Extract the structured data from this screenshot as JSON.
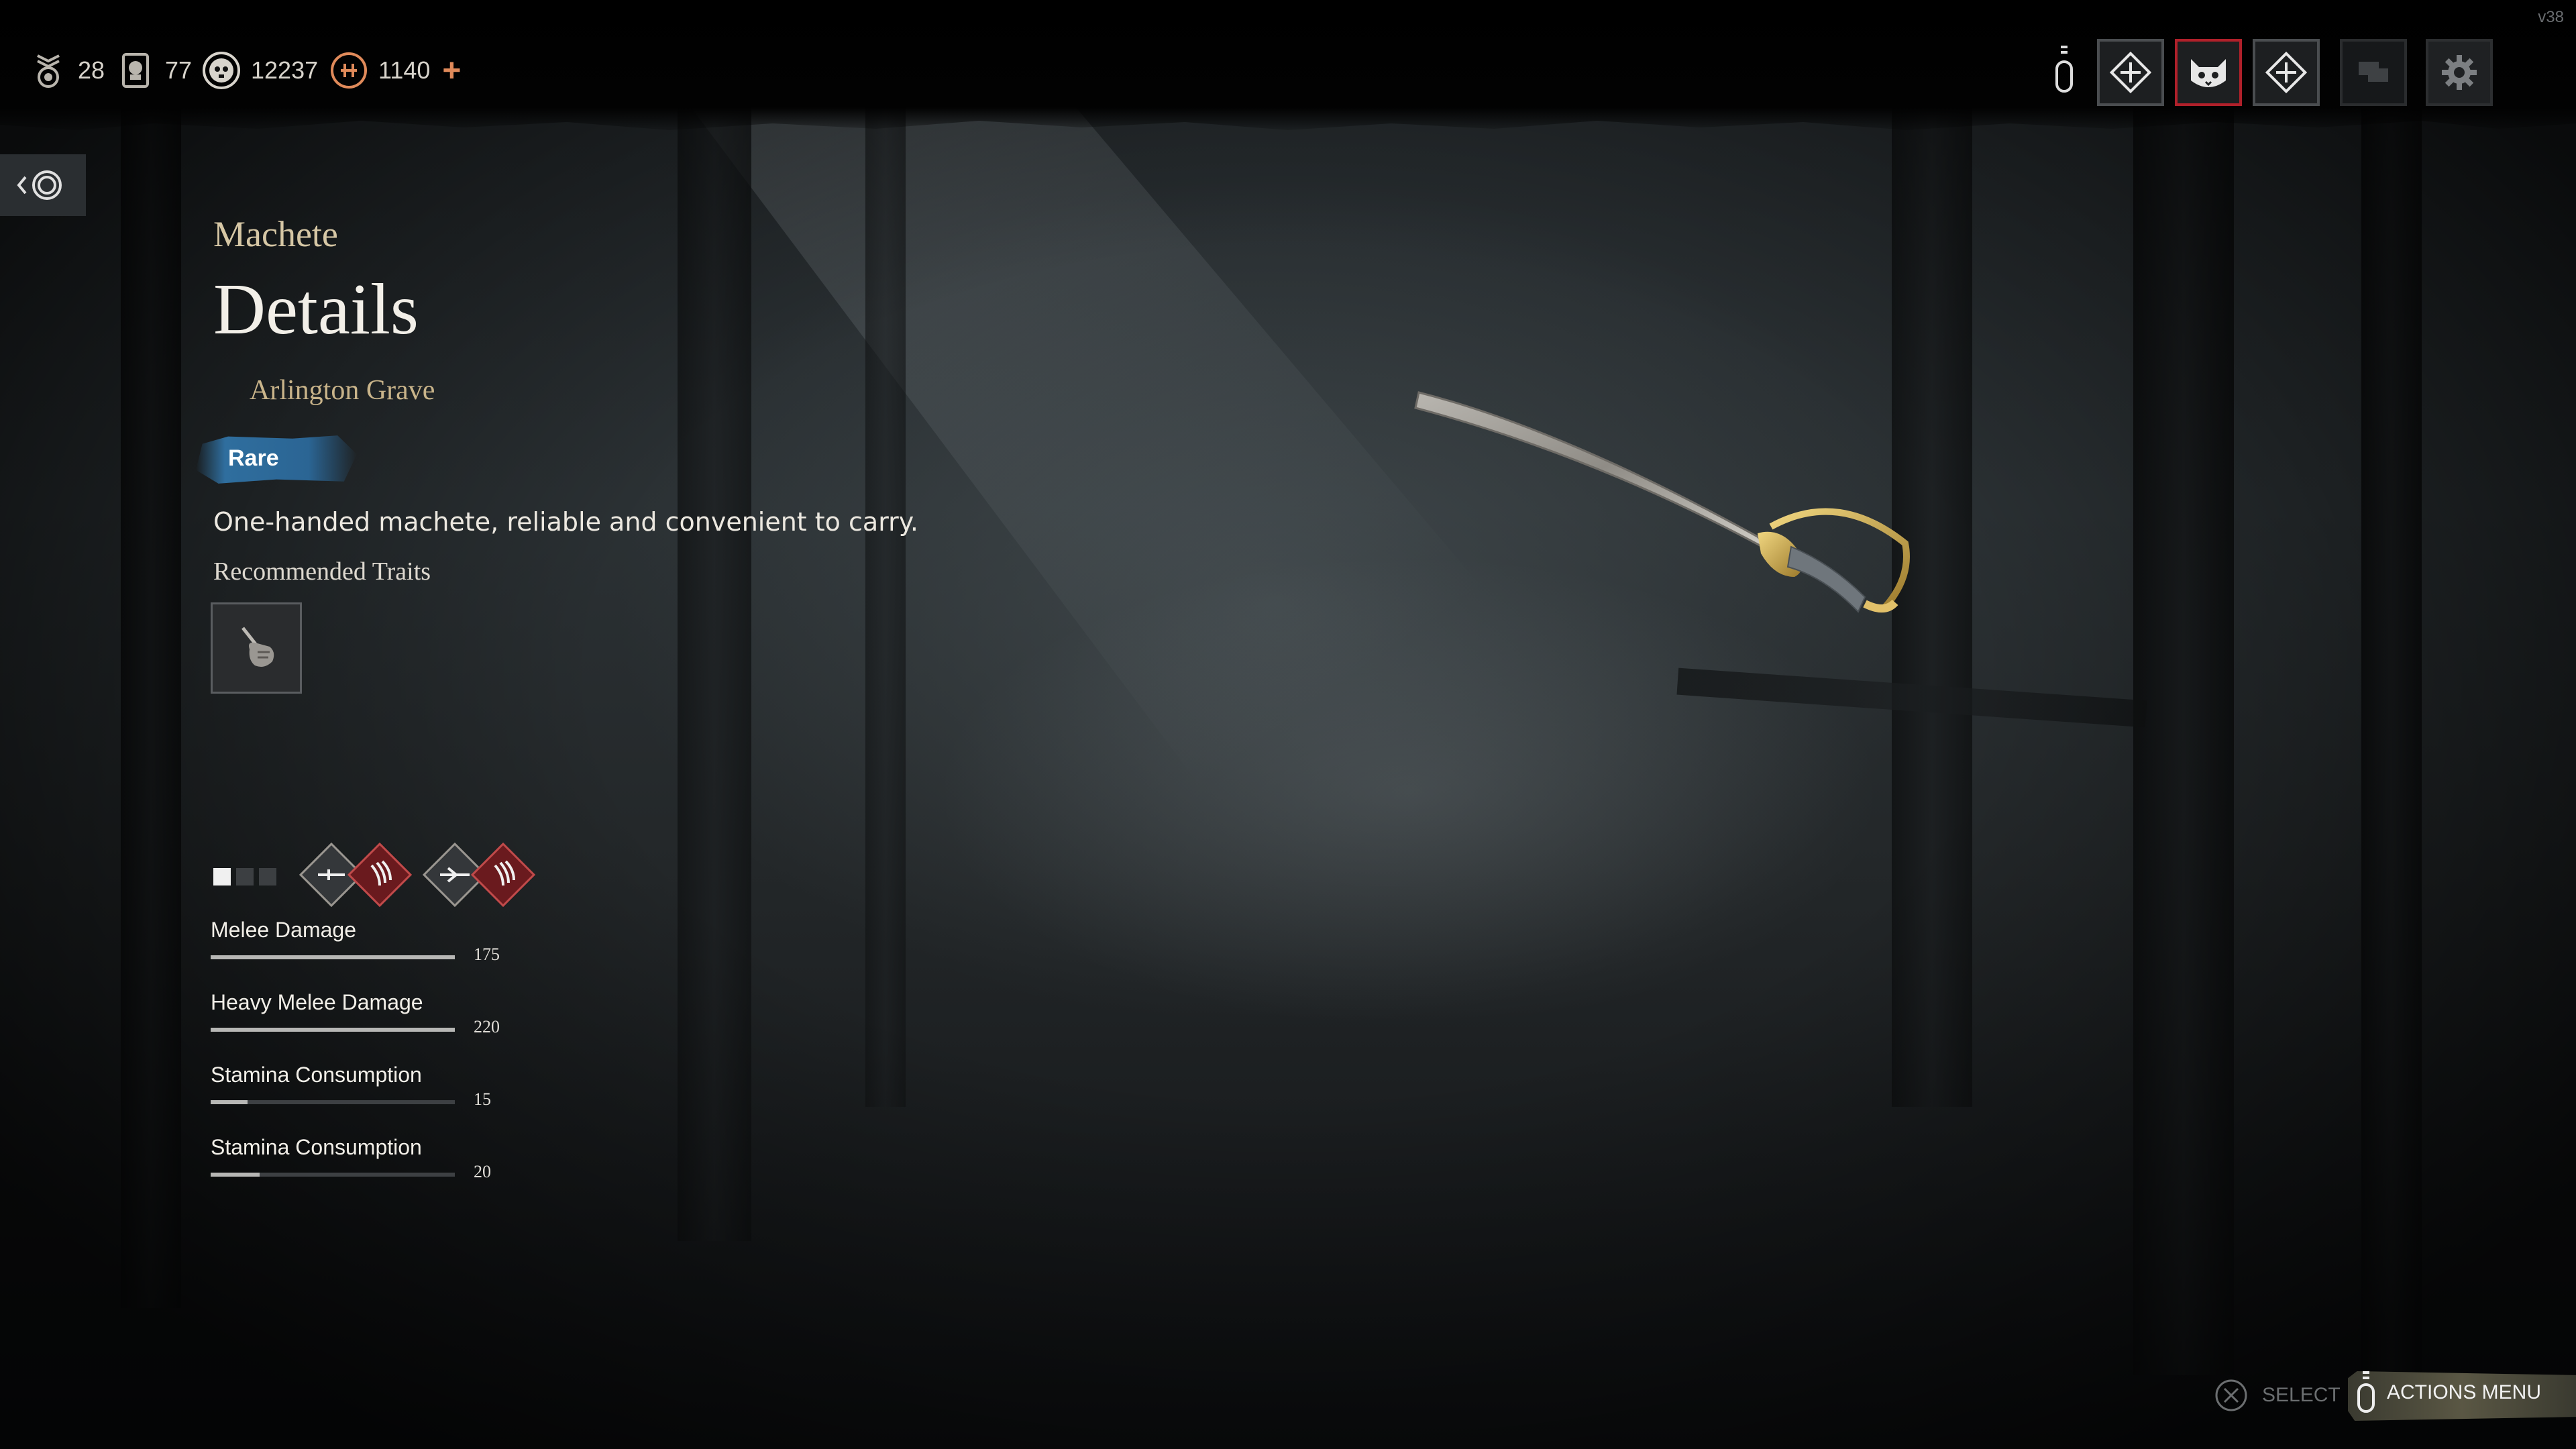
{
  "version": "v38",
  "currencies": [
    {
      "icon": "rank-icon",
      "value": "28"
    },
    {
      "icon": "skull-token-icon",
      "value": "77"
    },
    {
      "icon": "bone-coin-icon",
      "value": "12237"
    },
    {
      "icon": "premium-currency-icon",
      "value": "1140",
      "add": "+"
    }
  ],
  "top_right": {
    "slots": [
      {
        "name": "loadout-slot-1",
        "icon": "crosshair-diamond-icon",
        "active": false
      },
      {
        "name": "character-slot-cat",
        "icon": "cat-mask-icon",
        "active": true
      },
      {
        "name": "loadout-slot-2",
        "icon": "crosshair-diamond-icon",
        "active": false
      }
    ],
    "chat_icon": "chat-icon",
    "settings_icon": "gear-icon"
  },
  "item": {
    "type": "Machete",
    "title": "Details",
    "collection": "Arlington Grave",
    "rarity": "Rare",
    "description": "One-handed machete, reliable and convenient to carry.",
    "recommended_traits_label": "Recommended Traits",
    "trait_icon": "hand-blade-icon"
  },
  "pager": {
    "total": 3,
    "current": 1
  },
  "stats": [
    {
      "label": "Melee Damage",
      "value": "175",
      "fill": 1.0
    },
    {
      "label": "Heavy Melee Damage",
      "value": "220",
      "fill": 1.0
    },
    {
      "label": "Stamina Consumption",
      "value": "15",
      "fill": 0.15
    },
    {
      "label": "Stamina Consumption",
      "value": "20",
      "fill": 0.2
    }
  ],
  "footer": {
    "select_label": "SELECT",
    "actions_label": "ACTIONS MENU"
  },
  "colors": {
    "accent_red": "#b0202a",
    "rarity_blue": "#2f6e9e",
    "currency_orange": "#e08a5a",
    "title_gold": "#d6c7a5"
  }
}
